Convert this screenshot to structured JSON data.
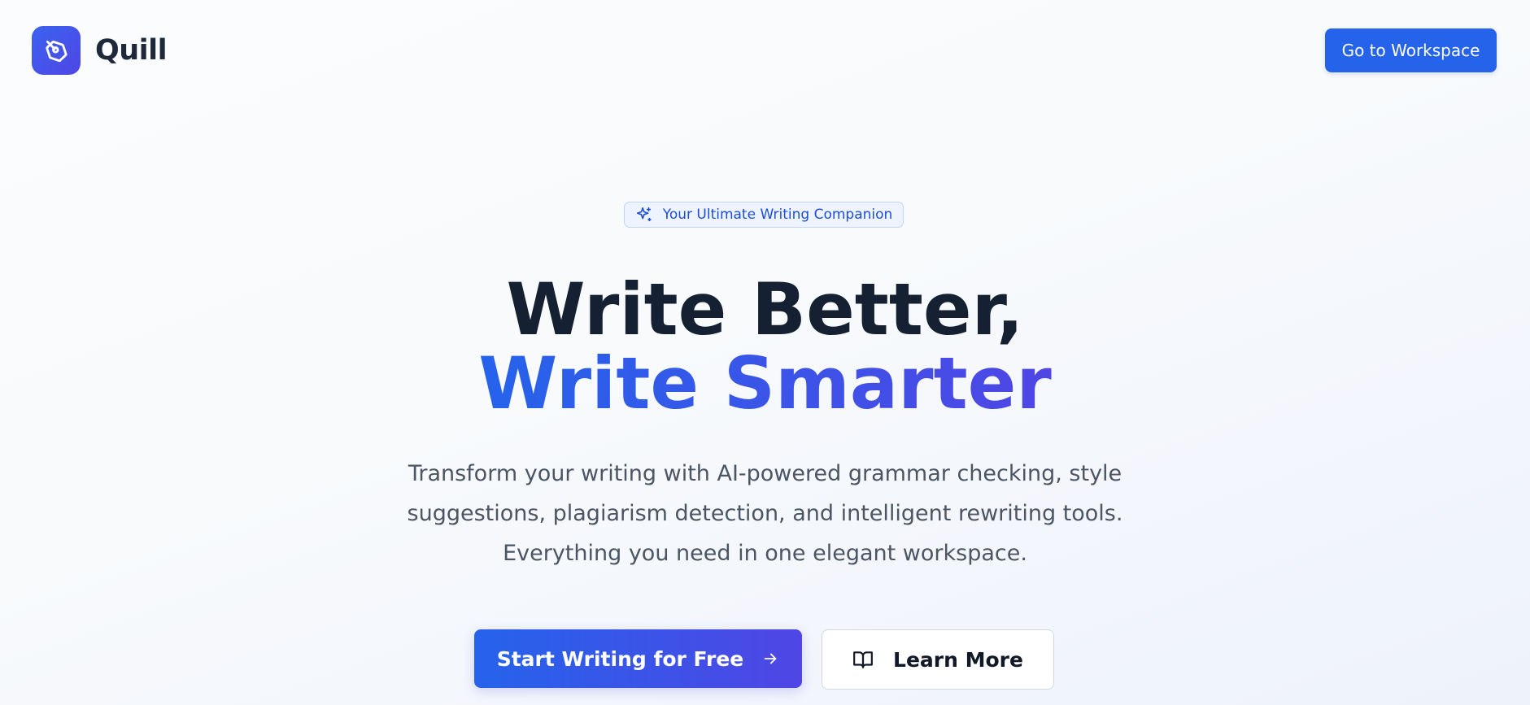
{
  "header": {
    "brand_name": "Quill",
    "logo_icon": "pen-nib-icon",
    "workspace_button_label": "Go to Workspace"
  },
  "hero": {
    "badge": {
      "icon": "sparkles-icon",
      "label": "Your Ultimate Writing Companion"
    },
    "headline_line1": "Write Better,",
    "headline_line2": "Write Smarter",
    "subtitle": "Transform your writing with AI-powered grammar checking, style suggestions, plagiarism detection, and intelligent rewriting tools. Everything you need in one elegant workspace.",
    "primary_cta": {
      "label": "Start Writing for Free",
      "icon": "arrow-right-icon"
    },
    "secondary_cta": {
      "label": "Learn More",
      "icon": "book-open-icon"
    }
  },
  "colors": {
    "accent": "#2563eb",
    "accent_gradient_end": "#4f46e5",
    "heading": "#162033",
    "body_text": "#4b5563"
  }
}
